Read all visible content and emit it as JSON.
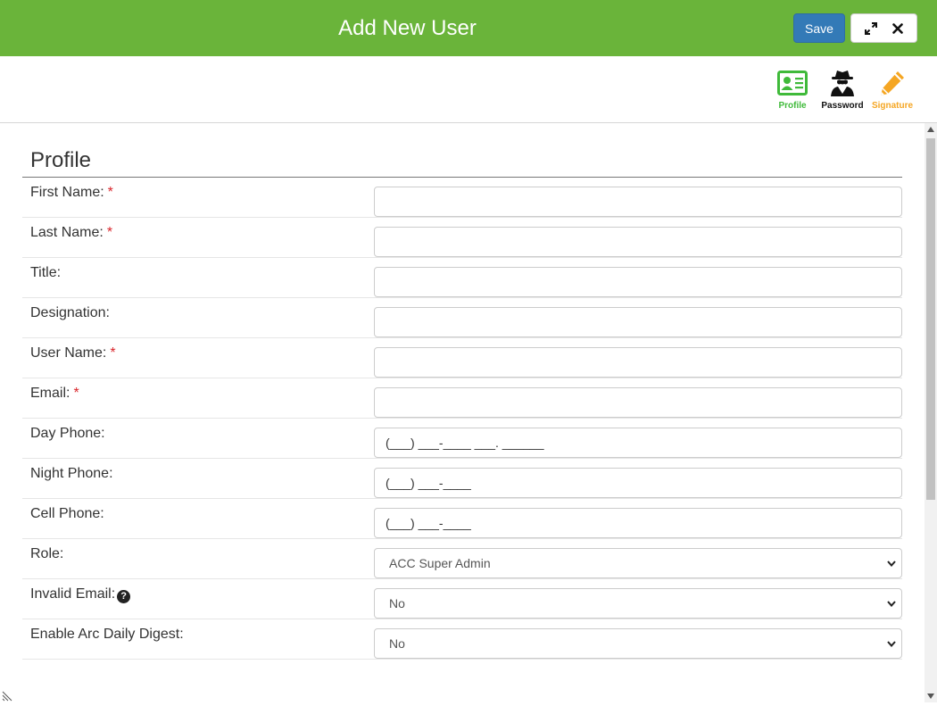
{
  "header": {
    "title": "Add New User",
    "save_label": "Save",
    "accent_color": "#6ab43a",
    "save_color": "#337ab7"
  },
  "tabs": [
    {
      "label": "Profile",
      "icon": "id-card-icon",
      "color": "#3fba3a"
    },
    {
      "label": "Password",
      "icon": "user-secret-icon",
      "color": "#111111"
    },
    {
      "label": "Signature",
      "icon": "pencil-icon",
      "color": "#f5a623"
    }
  ],
  "profile": {
    "section_title": "Profile",
    "fields": [
      {
        "label": "First Name:",
        "required": "*",
        "value": ""
      },
      {
        "label": "Last Name:",
        "required": "*",
        "value": ""
      },
      {
        "label": "Title:",
        "value": ""
      },
      {
        "label": "Designation:",
        "value": ""
      },
      {
        "label": "User Name:",
        "required": "*",
        "value": ""
      },
      {
        "label": "Email:",
        "required": "*",
        "value": ""
      },
      {
        "label": "Day Phone:",
        "value": "(___) ___-____ ___. ______"
      },
      {
        "label": "Night Phone:",
        "value": "(___) ___-____"
      },
      {
        "label": "Cell Phone:",
        "value": "(___) ___-____"
      },
      {
        "label": "Role:",
        "value": "ACC Super Admin"
      },
      {
        "label": "Invalid Email:",
        "value": "No",
        "help": "?"
      },
      {
        "label": "Enable Arc Daily Digest:",
        "value": "No"
      }
    ]
  }
}
